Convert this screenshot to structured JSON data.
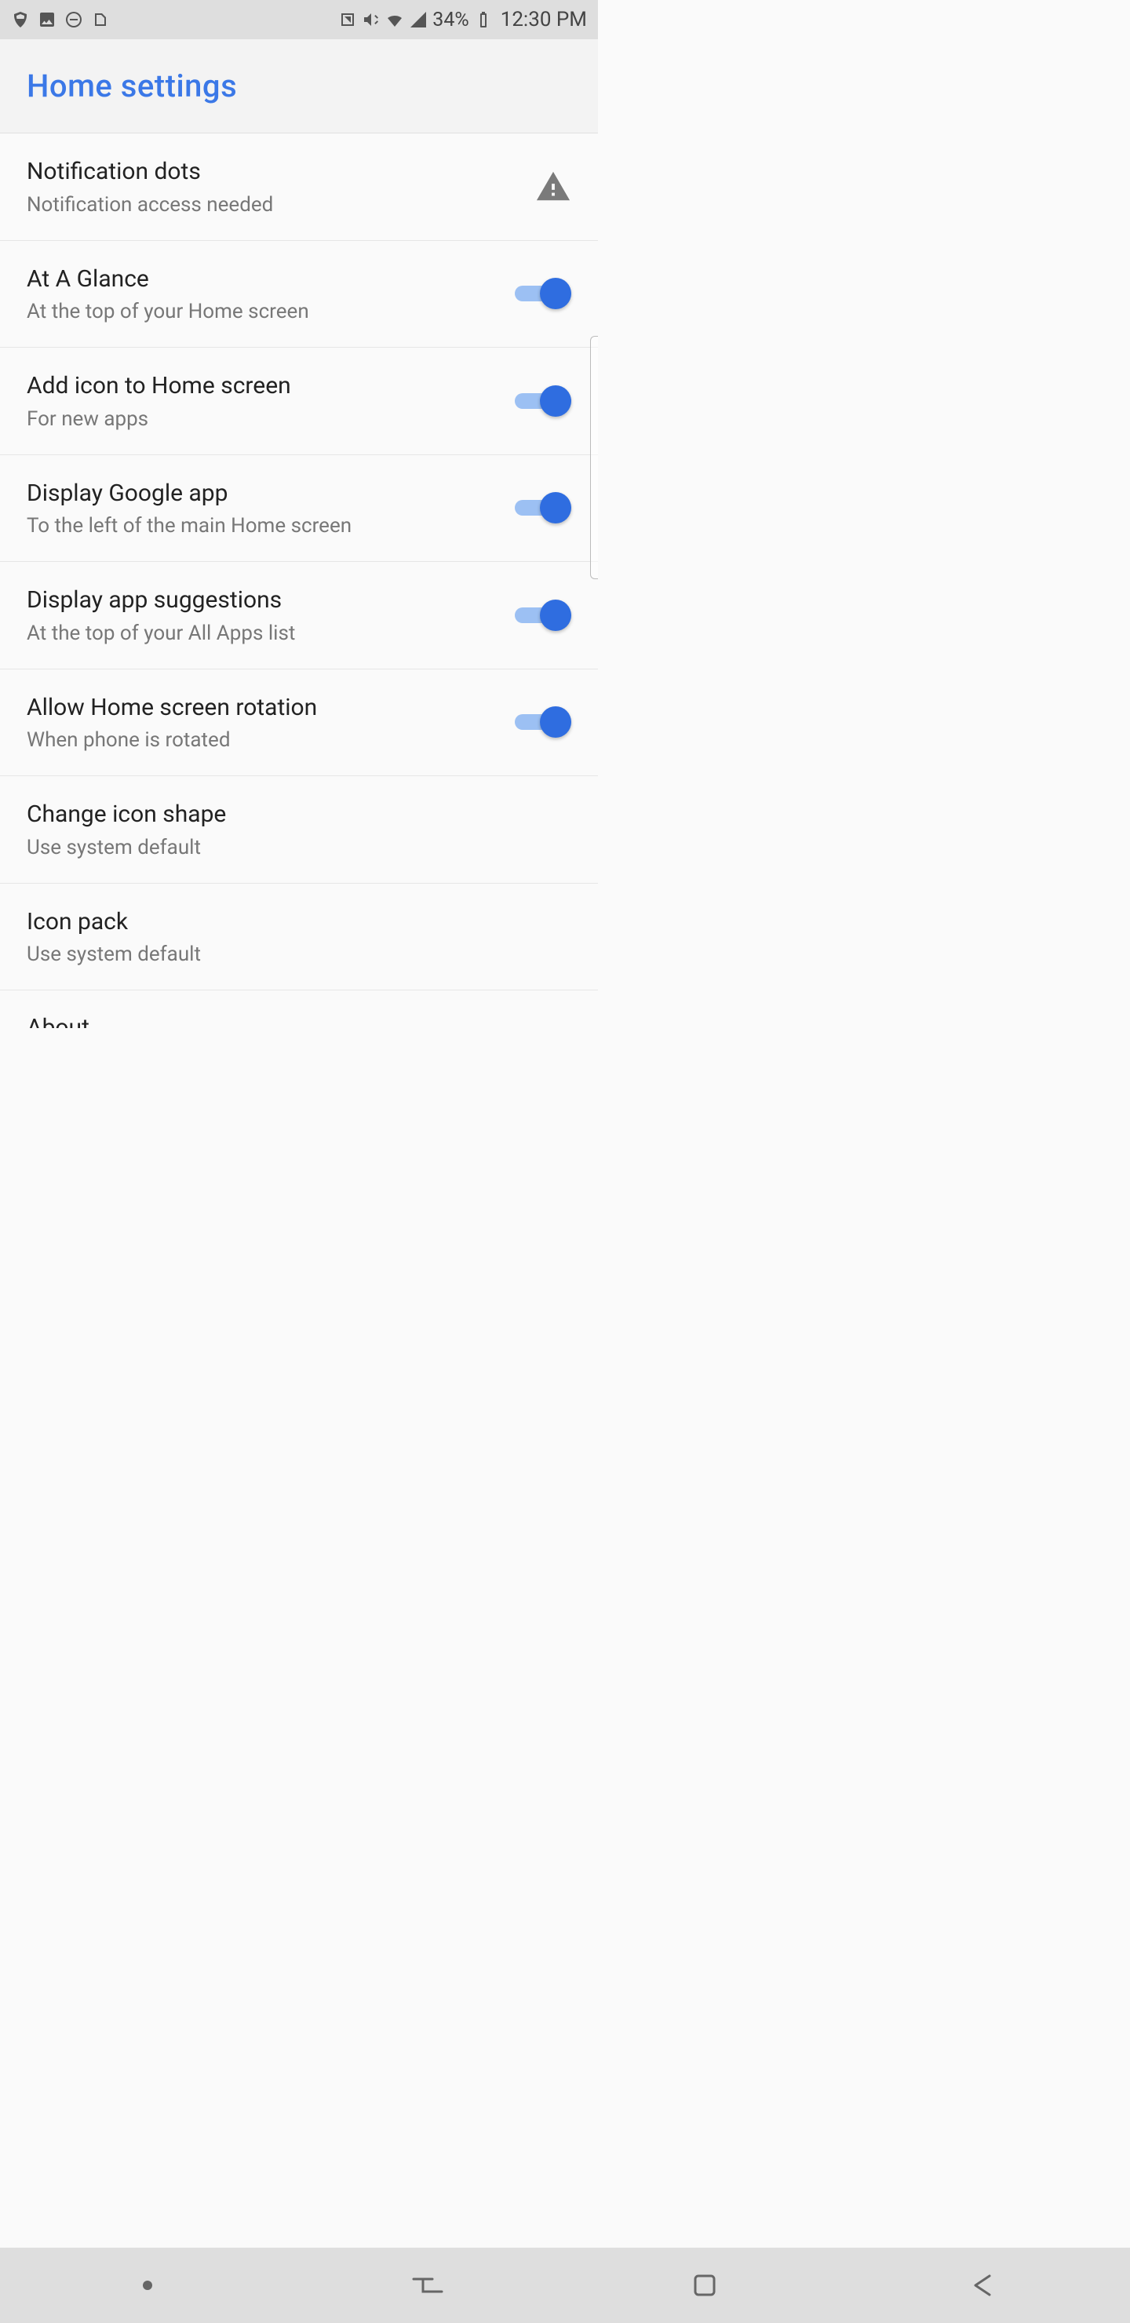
{
  "status": {
    "battery_pct": "34%",
    "clock": "12:30 PM"
  },
  "header": {
    "title": "Home settings"
  },
  "rows": {
    "notification_dots": {
      "title": "Notification dots",
      "sub": "Notification access needed"
    },
    "at_a_glance": {
      "title": "At A Glance",
      "sub": "At the top of your Home screen",
      "on": true
    },
    "add_icon": {
      "title": "Add icon to Home screen",
      "sub": "For new apps",
      "on": true
    },
    "display_google": {
      "title": "Display Google app",
      "sub": "To the left of the main Home screen",
      "on": true
    },
    "display_suggestions": {
      "title": "Display app suggestions",
      "sub": "At the top of your All Apps list",
      "on": true
    },
    "allow_rotation": {
      "title": "Allow Home screen rotation",
      "sub": "When phone is rotated",
      "on": true
    },
    "change_icon_shape": {
      "title": "Change icon shape",
      "sub": "Use system default"
    },
    "icon_pack": {
      "title": "Icon pack",
      "sub": "Use system default"
    },
    "about": {
      "title": "About"
    }
  }
}
